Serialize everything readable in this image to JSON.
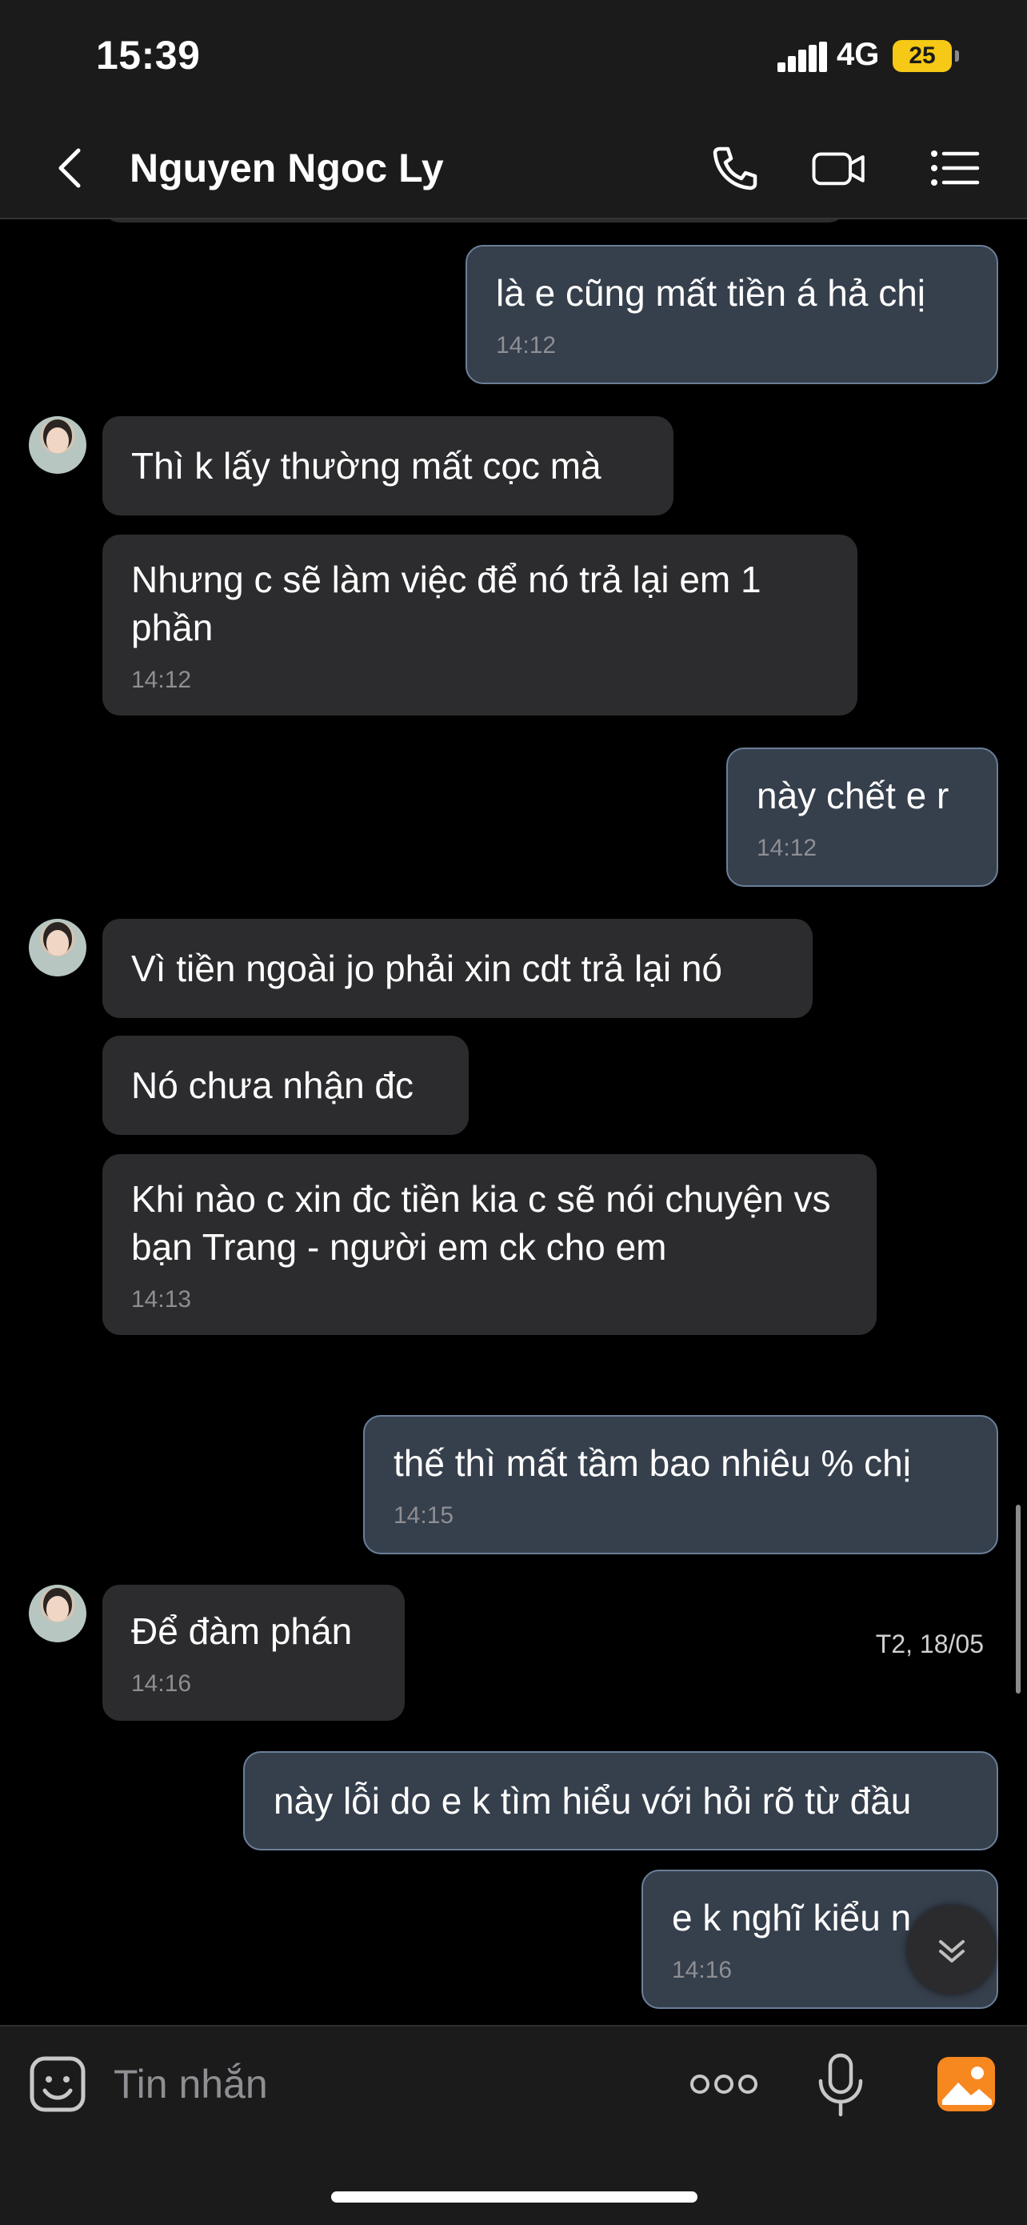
{
  "status_bar": {
    "time": "15:39",
    "network": "4G",
    "battery": "25"
  },
  "header": {
    "contact_name": "Nguyen Ngoc Ly"
  },
  "messages": [
    {
      "dir": "out",
      "text": "là e cũng mất tiền á hả chị",
      "time": "14:12"
    },
    {
      "dir": "in",
      "text": "Thì k lấy thường mất cọc mà",
      "time": ""
    },
    {
      "dir": "in",
      "text": "Nhưng c sẽ làm việc để nó trả lại em 1 phần",
      "time": "14:12"
    },
    {
      "dir": "out",
      "text": "này chết e r",
      "time": "14:12"
    },
    {
      "dir": "in",
      "text": "Vì tiền ngoài jo phải xin cdt trả lại nó",
      "time": ""
    },
    {
      "dir": "in",
      "text": "Nó chưa nhận đc",
      "time": ""
    },
    {
      "dir": "in",
      "text": "Khi nào c xin đc tiền kia c sẽ nói chuyện vs bạn Trang - người em ck cho em",
      "time": "14:13"
    },
    {
      "dir": "out",
      "text": "thế thì mất tầm bao nhiêu % chị",
      "time": "14:15"
    },
    {
      "dir": "in",
      "text": "Để đàm phán",
      "time": "14:16"
    },
    {
      "dir": "out",
      "text": "này lỗi do e k tìm hiểu với hỏi rõ từ đầu",
      "time": ""
    },
    {
      "dir": "out",
      "text": "e k nghĩ kiểu n",
      "time": "14:16"
    }
  ],
  "date_separator": "T2, 18/05",
  "input": {
    "placeholder": "Tin nhắn"
  },
  "colors": {
    "incoming_bubble": "#2c2c2e",
    "outgoing_bubble": "#363f4c",
    "outgoing_border": "#6a7f99",
    "gallery_accent": "#f7871f"
  },
  "icons": [
    "back-icon",
    "phone-icon",
    "video-icon",
    "menu-icon",
    "sticker-icon",
    "more-icon",
    "mic-icon",
    "gallery-icon",
    "scroll-down-icon"
  ]
}
